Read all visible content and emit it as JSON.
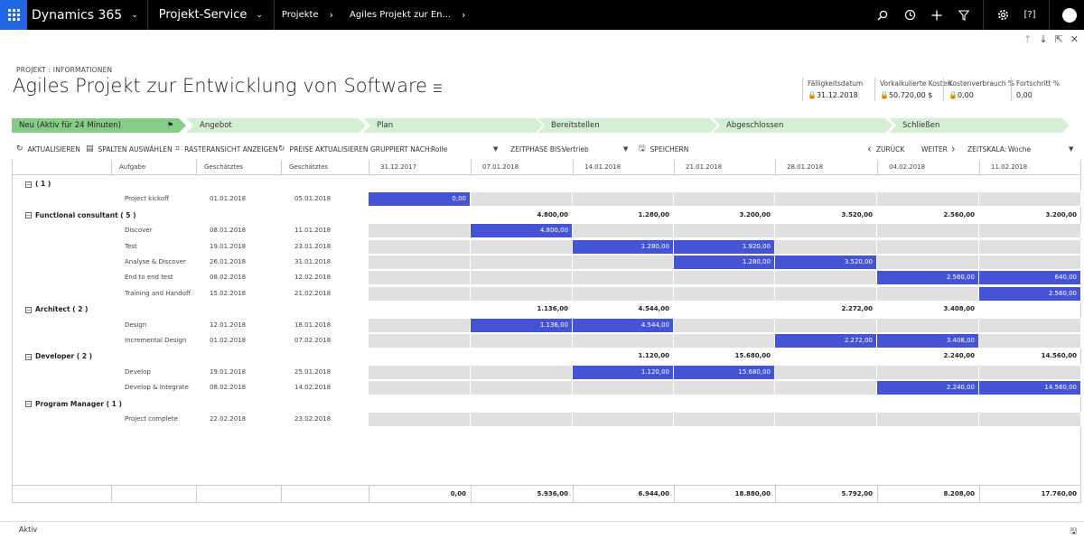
{
  "nav": {
    "app_name": "Dynamics 365",
    "area": "Projekt-Service",
    "breadcrumb": [
      "Projekte",
      "Agiles Projekt zur En..."
    ]
  },
  "page": {
    "entity_label": "PROJEKT : INFORMATIONEN",
    "title": "Agiles Projekt zur Entwicklung von Software"
  },
  "header_fields": [
    {
      "label": "Fälligkeitsdatum",
      "value": "31.12.2018"
    },
    {
      "label": "Vorkalkulierte Kosten",
      "value": "50.720,00 $"
    },
    {
      "label": "Kostenverbrauch %",
      "value": "0,00"
    },
    {
      "label": "Fortschritt %",
      "value": "0,00"
    }
  ],
  "stages": [
    {
      "label": "Neu (Aktiv für 24 Minuten)",
      "active": true
    },
    {
      "label": "Angebot",
      "active": false
    },
    {
      "label": "Plan",
      "active": false
    },
    {
      "label": "Bereitstellen",
      "active": false
    },
    {
      "label": "Abgeschlossen",
      "active": false
    },
    {
      "label": "Schließen",
      "active": false
    }
  ],
  "toolbar": {
    "refresh": "AKTUALISIEREN",
    "columns": "SPALTEN AUSWÄHLEN",
    "gridview": "RASTERANSICHT ANZEIGEN",
    "prices": "PREISE AKTUALISIEREN",
    "group_label": "GRUPPIERT NACH:",
    "group_value": "Rolle",
    "phase_label": "ZEITPHASE BIS:",
    "phase_value": "Vertrieb",
    "save": "SPEICHERN",
    "back": "ZURÜCK",
    "next": "WEITER",
    "scale_label": "ZEITSKALA:",
    "scale_value": "Woche"
  },
  "grid": {
    "headers": [
      "Aufgabe",
      "Geschätztes",
      "Geschätztes"
    ],
    "weeks": [
      "31.12.2017",
      "07.01.2018",
      "14.01.2018",
      "21.01.2018",
      "28.01.2018",
      "04.02.2018",
      "11.02.2018"
    ],
    "rows": [
      {
        "type": "group",
        "label": "( 1 )",
        "values": [
          "",
          "",
          "",
          "",
          "",
          "",
          ""
        ]
      },
      {
        "type": "task",
        "name": "Project kickoff",
        "start": "01.01.2018",
        "end": "05.01.2018",
        "cells": [
          "0,00",
          null,
          null,
          null,
          null,
          null,
          null
        ]
      },
      {
        "type": "group",
        "label": "Functional consultant ( 5 )",
        "values": [
          "",
          "4.800,00",
          "1.280,00",
          "3.200,00",
          "3.520,00",
          "2.560,00",
          "3.200,00"
        ]
      },
      {
        "type": "task",
        "name": "Discover",
        "start": "08.01.2018",
        "end": "11.01.2018",
        "cells": [
          null,
          "4.800,00",
          null,
          null,
          null,
          null,
          null
        ]
      },
      {
        "type": "task",
        "name": "Test",
        "start": "19.01.2018",
        "end": "23.01.2018",
        "cells": [
          null,
          null,
          "1.280,00",
          "1.920,00",
          null,
          null,
          null
        ]
      },
      {
        "type": "task",
        "name": "Analyse & Discover",
        "start": "26.01.2018",
        "end": "31.01.2018",
        "cells": [
          null,
          null,
          null,
          "1.280,00",
          "3.520,00",
          null,
          null
        ]
      },
      {
        "type": "task",
        "name": "End to end test",
        "start": "08.02.2018",
        "end": "12.02.2018",
        "cells": [
          null,
          null,
          null,
          null,
          null,
          "2.560,00",
          "640,00"
        ]
      },
      {
        "type": "task",
        "name": "Training and Handoff",
        "start": "15.02.2018",
        "end": "21.02.2018",
        "cells": [
          null,
          null,
          null,
          null,
          null,
          null,
          "2.560,00"
        ]
      },
      {
        "type": "group",
        "label": "Architect ( 2 )",
        "values": [
          "",
          "1.136,00",
          "4.544,00",
          "",
          "2.272,00",
          "3.408,00",
          ""
        ]
      },
      {
        "type": "task",
        "name": "Design",
        "start": "12.01.2018",
        "end": "18.01.2018",
        "cells": [
          null,
          "1.136,00",
          "4.544,00",
          null,
          null,
          null,
          null
        ]
      },
      {
        "type": "task",
        "name": "Incremental Design",
        "start": "01.02.2018",
        "end": "07.02.2018",
        "cells": [
          null,
          null,
          null,
          null,
          "2.272,00",
          "3.408,00",
          null
        ]
      },
      {
        "type": "group",
        "label": "Developer ( 2 )",
        "values": [
          "",
          "",
          "1.120,00",
          "15.680,00",
          "",
          "2.240,00",
          "14.560,00"
        ]
      },
      {
        "type": "task",
        "name": "Develop",
        "start": "19.01.2018",
        "end": "25.01.2018",
        "cells": [
          null,
          null,
          "1.120,00",
          "15.680,00",
          null,
          null,
          null
        ]
      },
      {
        "type": "task",
        "name": "Develop & Integrate",
        "start": "08.02.2018",
        "end": "14.02.2018",
        "cells": [
          null,
          null,
          null,
          null,
          null,
          "2.240,00",
          "14.560,00"
        ]
      },
      {
        "type": "group",
        "label": "Program Manager ( 1 )",
        "values": [
          "",
          "",
          "",
          "",
          "",
          "",
          ""
        ]
      },
      {
        "type": "task",
        "name": "Project complete",
        "start": "22.02.2018",
        "end": "23.02.2018",
        "cells": [
          null,
          null,
          null,
          null,
          null,
          null,
          null
        ]
      }
    ],
    "totals": [
      "0,00",
      "5.936,00",
      "6.944,00",
      "18.880,00",
      "5.792,00",
      "8.208,00",
      "17.760,00"
    ]
  },
  "status": {
    "text": "Aktiv"
  },
  "colors": {
    "accent": "#2266e3",
    "active_stage": "#86cc86",
    "stage": "#d4efd4",
    "cell_filled": "#4454d4",
    "cell_empty": "#e0e0e0"
  }
}
